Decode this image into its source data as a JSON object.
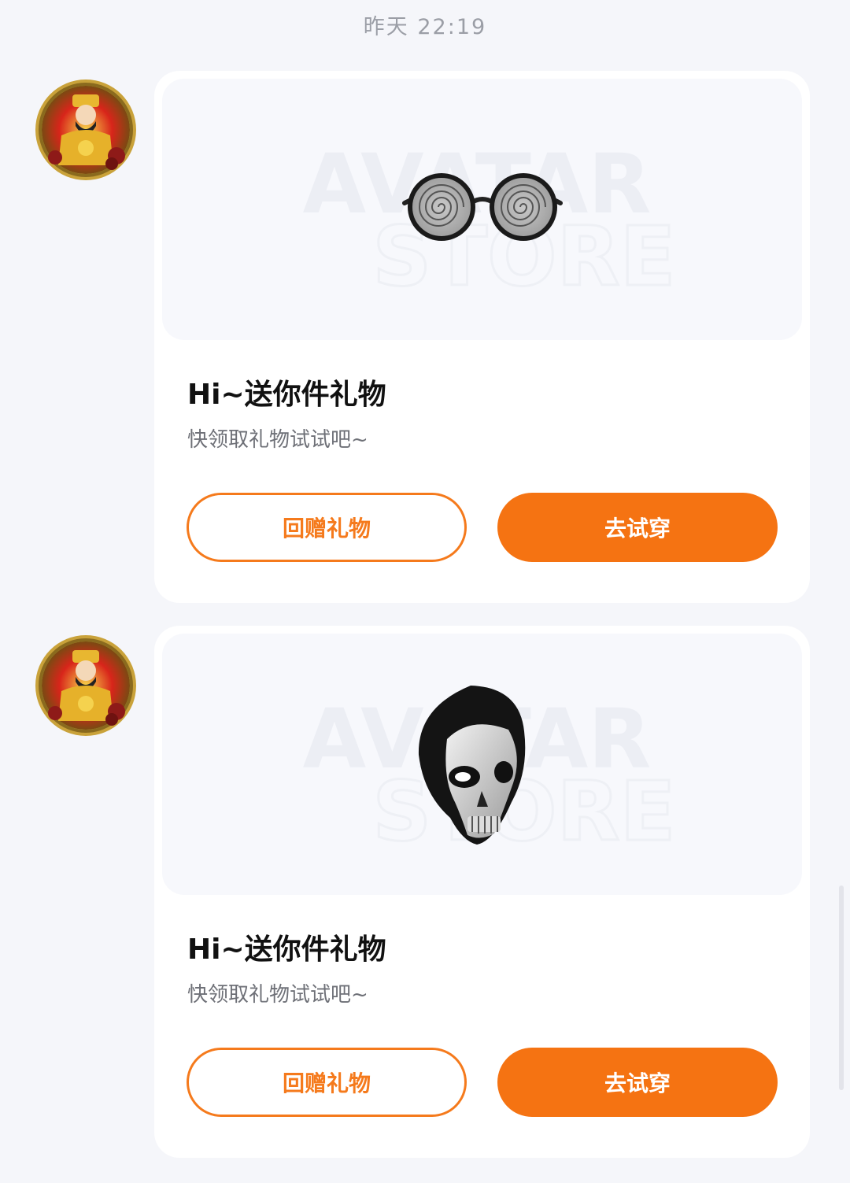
{
  "timestamp": "昨天 22:19",
  "messages": [
    {
      "title": "Hi~送你件礼物",
      "subtitle": "快领取礼物试试吧~",
      "return_gift_label": "回赠礼物",
      "try_on_label": "去试穿",
      "item": "hypno-glasses"
    },
    {
      "title": "Hi~送你件礼物",
      "subtitle": "快领取礼物试试吧~",
      "return_gift_label": "回赠礼物",
      "try_on_label": "去试穿",
      "item": "skull-mask"
    }
  ],
  "watermark": {
    "line1": "AVATAR",
    "line2": "STORE"
  },
  "colors": {
    "accent": "#f57312",
    "page_bg": "#f5f6fa",
    "card_bg": "#ffffff"
  },
  "icons": [
    "avatar-caishen-icon",
    "hypno-glasses-icon",
    "skull-mask-icon"
  ]
}
